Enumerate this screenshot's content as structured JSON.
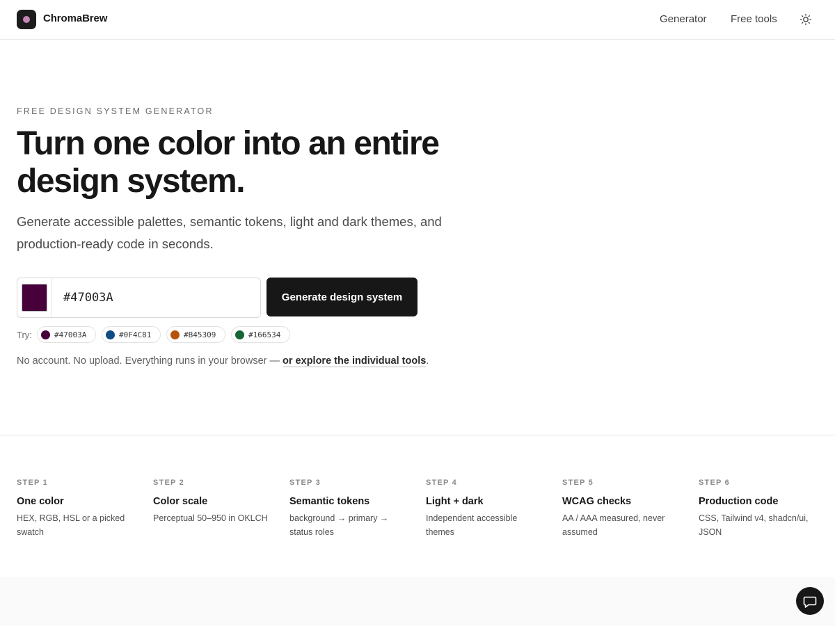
{
  "header": {
    "brand": "ChromaBrew",
    "nav": {
      "generator": "Generator",
      "free_tools": "Free tools"
    },
    "logo_dot_color": "#C486B4"
  },
  "hero": {
    "eyebrow": "FREE DESIGN SYSTEM GENERATOR",
    "headline_line1": "Turn one color into an entire",
    "headline_line2": "design system.",
    "subhead": "Generate accessible palettes, semantic tokens, light and dark themes, and production-ready code in seconds.",
    "input": {
      "value": "#47003A",
      "swatch_color": "#47003A"
    },
    "generate_label": "Generate design system",
    "try_label": "Try:",
    "presets": [
      {
        "label": "#47003A",
        "color": "#47003A"
      },
      {
        "label": "#0F4C81",
        "color": "#0F4C81"
      },
      {
        "label": "#B45309",
        "color": "#B45309"
      },
      {
        "label": "#166534",
        "color": "#166534"
      }
    ],
    "note_text": "No account. No upload. Everything runs in your browser — ",
    "note_link": "or explore the individual tools",
    "note_end": "."
  },
  "steps": [
    {
      "num": "STEP 1",
      "title": "One color",
      "desc": "HEX, RGB, HSL or a picked swatch"
    },
    {
      "num": "STEP 2",
      "title": "Color scale",
      "desc": "Perceptual 50–950 in OKLCH"
    },
    {
      "num": "STEP 3",
      "title": "Semantic tokens",
      "desc": "background → primary → status roles"
    },
    {
      "num": "STEP 4",
      "title": "Light + dark",
      "desc": "Independent accessible themes"
    },
    {
      "num": "STEP 5",
      "title": "WCAG checks",
      "desc": "AA / AAA measured, never assumed"
    },
    {
      "num": "STEP 6",
      "title": "Production code",
      "desc": "CSS, Tailwind v4, shadcn/ui, JSON"
    }
  ],
  "icons": {
    "theme": "sun-icon",
    "chat": "chat-bubble-icon",
    "logo": "logo-icon"
  }
}
